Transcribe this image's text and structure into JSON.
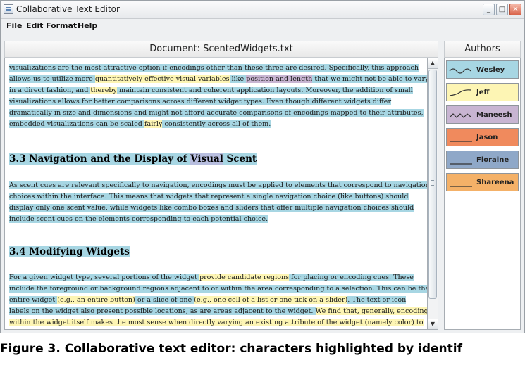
{
  "window": {
    "title": "Collaborative Text Editor",
    "controls": [
      "_",
      "□",
      "✕"
    ]
  },
  "menu": [
    "File",
    "Edit",
    "Format",
    "Help"
  ],
  "document": {
    "header": "Document: ScentedWidgets.txt",
    "para1": [
      [
        {
          "t": "visualizations are the most attractive option if encodings other than these three are desired.  Specifically, this approach",
          "c": "b"
        }
      ],
      [
        {
          "t": "allows us to utilize more ",
          "c": "b"
        },
        {
          "t": "quantitatively effective visual variables",
          "c": "y"
        },
        {
          "t": " like ",
          "c": "b"
        },
        {
          "t": "position and length",
          "c": "p"
        },
        {
          "t": " that we might not be able to vary",
          "c": "b"
        }
      ],
      [
        {
          "t": "in a direct fashion, and ",
          "c": "b"
        },
        {
          "t": "thereby",
          "c": "y"
        },
        {
          "t": " maintain consistent and coherent application layouts. Moreover, the addition of small",
          "c": "b"
        }
      ],
      [
        {
          "t": "visualizations allows for better comparisons across different widget types. Even though different widgets differ",
          "c": "b"
        }
      ],
      [
        {
          "t": "dramatically in size and dimensions and might not afford accurate comparisons of encodings mapped to their attributes,",
          "c": "b"
        }
      ],
      [
        {
          "t": "embedded visualizations can be scaled ",
          "c": "b"
        },
        {
          "t": "fairly",
          "c": "y"
        },
        {
          "t": " consistently across all of them.",
          "c": "b"
        }
      ]
    ],
    "heading1": [
      {
        "t": "3.3 Navigation and the Display of ",
        "c": "b"
      },
      {
        "t": "Visual",
        "c": "pb"
      },
      {
        "t": " Scent",
        "c": "b"
      }
    ],
    "para2": [
      [
        {
          "t": "As scent cues are relevant specifically to navigation, encodings must be applied to elements that correspond to navigation",
          "c": "b"
        }
      ],
      [
        {
          "t": "choices within the interface. This means that widgets that represent a single navigation choice (like buttons) should",
          "c": "b"
        }
      ],
      [
        {
          "t": "display only one scent value, while widgets like combo boxes and sliders that offer multiple navigation choices should",
          "c": "b"
        }
      ],
      [
        {
          "t": "include scent cues on the elements corresponding to each potential choice.",
          "c": "b"
        }
      ]
    ],
    "heading2": [
      {
        "t": "3.4 Modifying Widgets",
        "c": "b"
      }
    ],
    "para3": [
      [
        {
          "t": "For a given widget type, several portions of the widget ",
          "c": "b"
        },
        {
          "t": "provide candidate regions",
          "c": "y"
        },
        {
          "t": " for placing or encoding cues.  These",
          "c": "b"
        }
      ],
      [
        {
          "t": "include the foreground or background regions adjacent to or within the area corresponding to a selection.  This can be the",
          "c": "b"
        }
      ],
      [
        {
          "t": "entire widget ",
          "c": "b"
        },
        {
          "t": "(e.g., an entire button)",
          "c": "y"
        },
        {
          "t": " or a slice of one ",
          "c": "b"
        },
        {
          "t": "(e.g., one cell of a list or one tick on a slider)",
          "c": "y"
        },
        {
          "t": ".  The text or icon",
          "c": "b"
        }
      ],
      [
        {
          "t": "labels on the widget also present possible locations, as are areas adjacent to the widget.  ",
          "c": "b"
        },
        {
          "t": "We find that, generally, encoding",
          "c": "y"
        }
      ],
      [
        {
          "t": "within the widget itself makes the most sense when directly varying an existing attribute of the widget (namely color) to",
          "c": "y"
        }
      ]
    ]
  },
  "authors": {
    "header": "Authors",
    "list": [
      {
        "name": "Wesley",
        "color": "#a7d6e3",
        "swatch": "wave"
      },
      {
        "name": "Jeff",
        "color": "#fdf5b4",
        "swatch": "curve"
      },
      {
        "name": "Maneesh",
        "color": "#c8b5d2",
        "swatch": "zigzag"
      },
      {
        "name": "Jason",
        "color": "#f08a5d",
        "swatch": "line"
      },
      {
        "name": "Floraine",
        "color": "#8fa8c8",
        "swatch": "line"
      },
      {
        "name": "Shareena",
        "color": "#f4b168",
        "swatch": "line"
      }
    ]
  },
  "caption": "Figure 3. Collaborative text editor: characters highlighted by identif"
}
